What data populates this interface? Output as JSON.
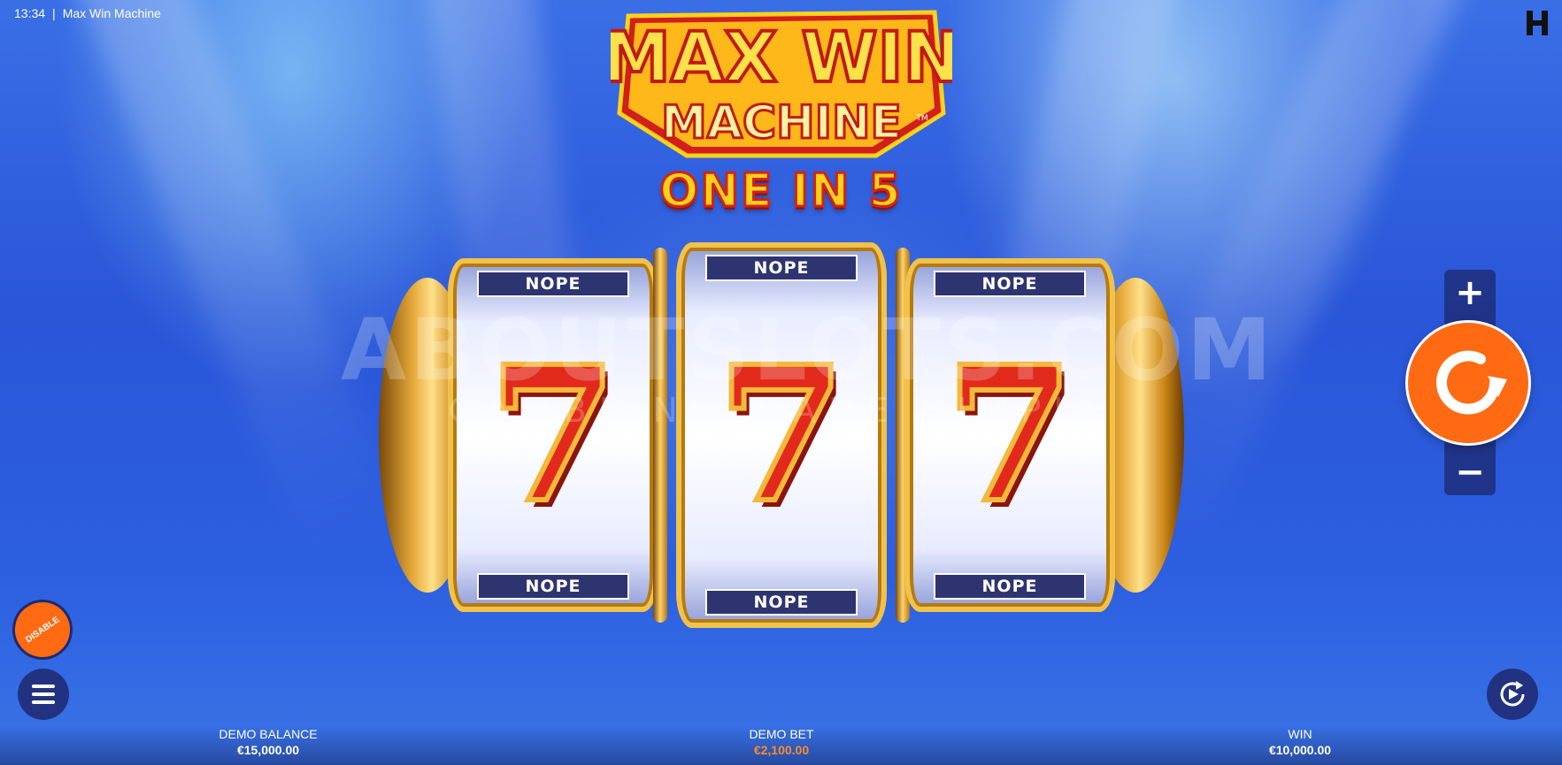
{
  "topbar": {
    "time": "13:34",
    "separator": "|",
    "game_title": "Max Win Machine"
  },
  "logo": {
    "line1": "MAX WIN",
    "line2": "MACHINE",
    "trademark": "TM"
  },
  "subtitle": "ONE IN 5",
  "reels": [
    {
      "top_label": "NOPE",
      "symbol": "7",
      "bottom_label": "NOPE"
    },
    {
      "top_label": "NOPE",
      "symbol": "7",
      "bottom_label": "NOPE"
    },
    {
      "top_label": "NOPE",
      "symbol": "7",
      "bottom_label": "NOPE"
    }
  ],
  "watermark": {
    "main": "ABOUTSLOTS.COM",
    "tagline": "GAMBLING MADE SIMPLE"
  },
  "controls": {
    "bet_increase": "+",
    "bet_decrease": "−",
    "disable_label": "DISABLE",
    "spin_icon": "spin-arrow-icon",
    "menu_icon": "hamburger-menu-icon",
    "autoplay_icon": "autoplay-icon"
  },
  "footer": {
    "balance_label": "DEMO BALANCE",
    "balance_value": "€15,000.00",
    "bet_label": "DEMO BET",
    "bet_value": "€2,100.00",
    "win_label": "WIN",
    "win_value": "€10,000.00"
  },
  "colors": {
    "accent_orange": "#ff6a13",
    "panel_navy": "#1e2a70",
    "seven_red": "#e22a1c",
    "gold": "#f3b93a"
  }
}
